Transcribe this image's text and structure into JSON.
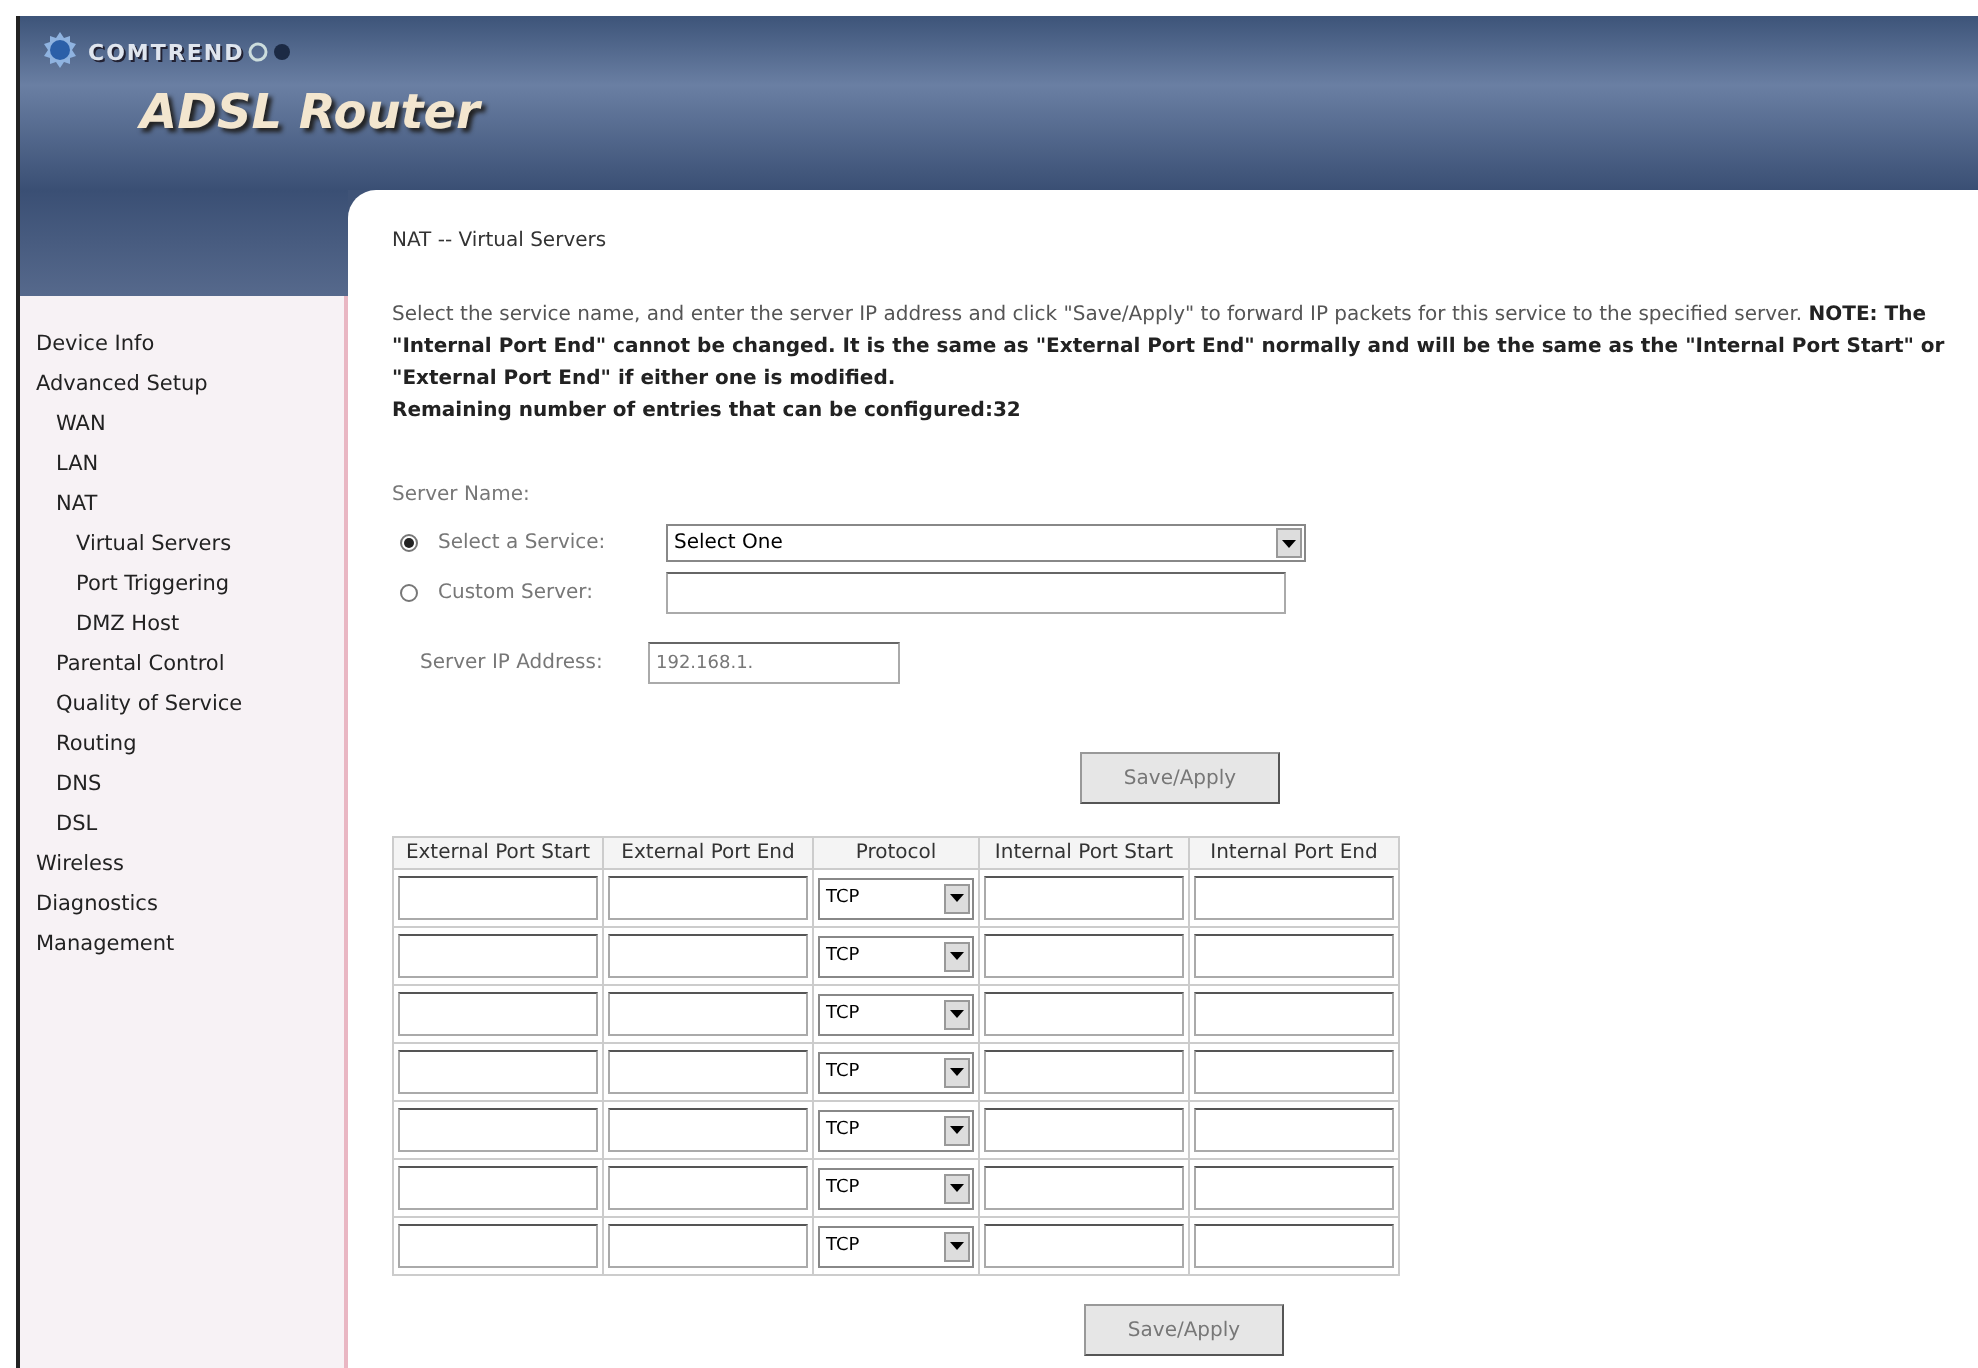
{
  "banner": {
    "brand": "COMTREND",
    "product": "ADSL Router"
  },
  "sidebar": {
    "items": [
      {
        "label": "Device Info"
      },
      {
        "label": "Advanced Setup",
        "children": [
          {
            "label": "WAN"
          },
          {
            "label": "LAN"
          },
          {
            "label": "NAT",
            "children": [
              {
                "label": "Virtual Servers"
              },
              {
                "label": "Port Triggering"
              },
              {
                "label": "DMZ Host"
              }
            ]
          },
          {
            "label": "Parental Control"
          },
          {
            "label": "Quality of Service"
          },
          {
            "label": "Routing"
          },
          {
            "label": "DNS"
          },
          {
            "label": "DSL"
          }
        ]
      },
      {
        "label": "Wireless"
      },
      {
        "label": "Diagnostics"
      },
      {
        "label": "Management"
      }
    ]
  },
  "page_title": "NAT -- Virtual Servers",
  "description": "Select the service name, and enter the server IP address and click \"Save/Apply\" to forward IP packets for this service to the specified server. **NOTE: The \"Internal Port End\" cannot be changed. It is the same as \"External Port End\" normally and will be the same as the \"Internal Port Start\" or \"External Port End\" if either one is modified.**",
  "remaining": "Remaining number of entries that can be configured:32",
  "server_name_label": "Server Name:",
  "server_options": [
    {
      "kind": "select",
      "label": "Select a Service:",
      "selected": true,
      "value": "Select One"
    },
    {
      "kind": "text",
      "label": "Custom Server:",
      "selected": false
    }
  ],
  "server_ip": {
    "label": "Server IP Address:",
    "value": "192.168.1."
  },
  "save_button_top": "Save/Apply",
  "table": {
    "columns": [
      "External Port Start",
      "External Port End",
      "Protocol",
      "Internal Port Start",
      "Internal Port End"
    ],
    "rows": [
      {
        "protocol": "TCP"
      },
      {
        "protocol": "TCP"
      },
      {
        "protocol": "TCP"
      },
      {
        "protocol": "TCP"
      },
      {
        "protocol": "TCP"
      },
      {
        "protocol": "TCP"
      },
      {
        "protocol": "TCP"
      }
    ]
  },
  "save_button_bottom": "Save/Apply"
}
